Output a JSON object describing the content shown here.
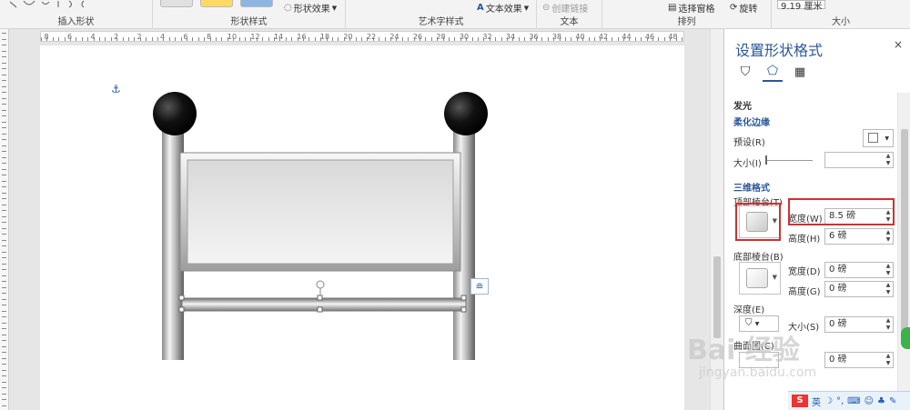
{
  "ribbon": {
    "groups": [
      {
        "label": "插入形状"
      },
      {
        "label": "形状样式"
      },
      {
        "label": "艺术字样式"
      },
      {
        "label": "文本"
      },
      {
        "label": "排列"
      },
      {
        "label": "大小"
      }
    ],
    "shape_effect_label": "形状效果",
    "text_effect_label": "文本效果",
    "create_link_label": "创建链接",
    "selection_pane_label": "选择窗格",
    "rotate_label": "旋转",
    "size_value": "9.19 厘米"
  },
  "ruler": {
    "numbers": [
      "8",
      "6",
      "4",
      "2",
      "2",
      "4",
      "6",
      "8",
      "10",
      "12",
      "14",
      "16",
      "18",
      "20",
      "22",
      "24",
      "26",
      "28",
      "30",
      "32",
      "34",
      "36",
      "38",
      "40",
      "42",
      "44",
      "46",
      "48"
    ]
  },
  "panel": {
    "title": "设置形状格式",
    "close": "×",
    "sections": {
      "glow": "发光",
      "soft_edges": "柔化边缘",
      "preset_label": "预设(R)",
      "size_label": "大小(I)",
      "three_d": "三维格式",
      "top_bevel": "顶部棱台(T)",
      "top_width_label": "宽度(W)",
      "top_width_value": "8.5 磅",
      "top_height_label": "高度(H)",
      "top_height_value": "6 磅",
      "bottom_bevel": "底部棱台(B)",
      "bottom_width_label": "宽度(D)",
      "bottom_width_value": "0 磅",
      "bottom_height_label": "高度(G)",
      "bottom_height_value": "0 磅",
      "depth": "深度(E)",
      "depth_size_label": "大小(S)",
      "depth_size_value": "0 磅",
      "contour": "曲面图(C)",
      "contour_size_value": "0 磅"
    }
  },
  "tray": {
    "ime": "英"
  },
  "watermark": {
    "text": "Bai 经验",
    "url": "jingyan.baidu.com"
  },
  "colors": {
    "accent": "#2b579a",
    "highlight": "#d32f2f"
  }
}
